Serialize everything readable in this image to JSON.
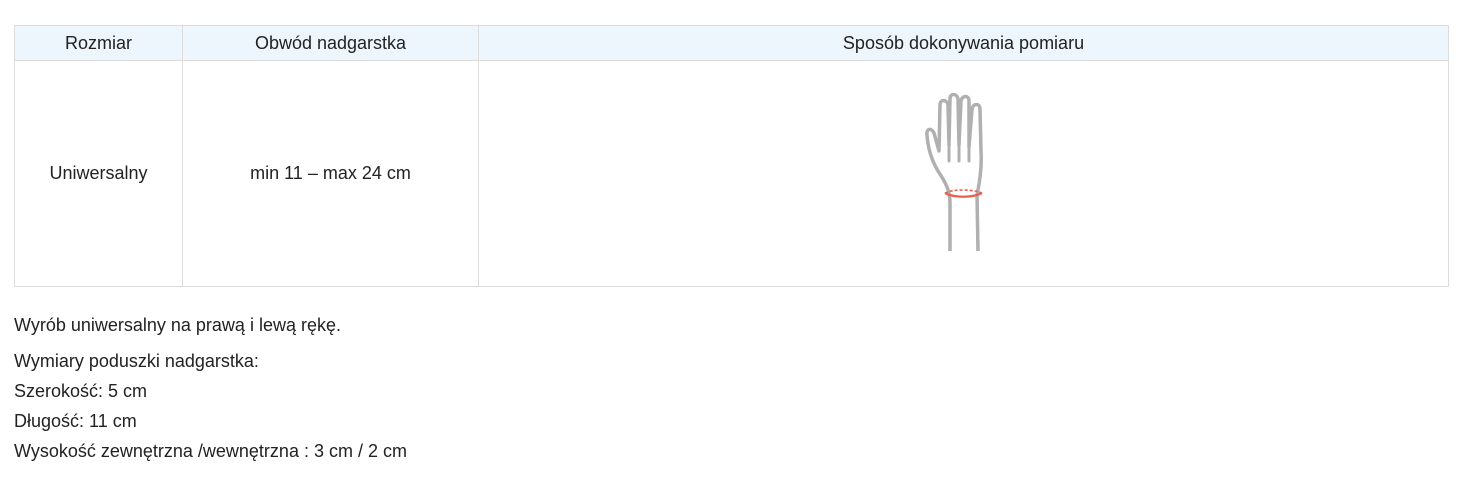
{
  "table": {
    "headers": {
      "size": "Rozmiar",
      "circumference": "Obwód nadgarstka",
      "method": "Sposób dokonywania pomiaru"
    },
    "rows": [
      {
        "size": "Uniwersalny",
        "circumference": "min 11 – max 24 cm",
        "illustration": "hand-wrist-measurement-icon"
      }
    ]
  },
  "notes": {
    "universal": "Wyrób uniwersalny na prawą i lewą rękę.",
    "pad_heading": "Wymiary poduszki nadgarstka:",
    "width": "Szerokość: 5 cm",
    "length": "Długość: 11 cm",
    "height": "Wysokość zewnętrzna /wewnętrzna : 3 cm / 2 cm"
  },
  "colors": {
    "header_bg": "#eef6fd",
    "border": "#dcdcdc",
    "hand_outline": "#b0b0b0",
    "measure_line": "#e8604c"
  }
}
